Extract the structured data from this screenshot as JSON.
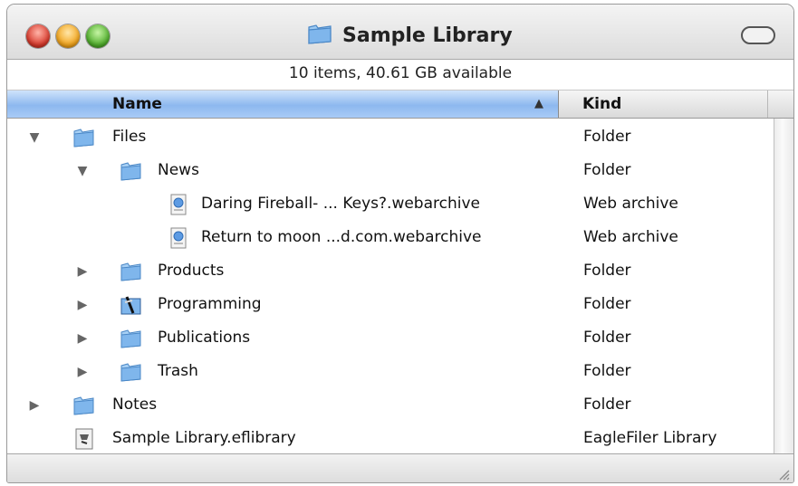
{
  "window": {
    "title": "Sample Library",
    "status": "10 items, 40.61 GB available"
  },
  "columns": {
    "name": "Name",
    "kind": "Kind"
  },
  "rows": [
    {
      "name": "Files",
      "kind": "Folder",
      "icon": "folder-icon",
      "expander": "expanded"
    },
    {
      "name": "News",
      "kind": "Folder",
      "icon": "folder-icon",
      "expander": "expanded"
    },
    {
      "name": "Daring Fireball- ... Keys?.webarchive",
      "kind": "Web archive",
      "icon": "webarchive-icon",
      "expander": "none"
    },
    {
      "name": "Return to moon ...d.com.webarchive",
      "kind": "Web archive",
      "icon": "webarchive-icon",
      "expander": "none"
    },
    {
      "name": "Products",
      "kind": "Folder",
      "icon": "folder-icon",
      "expander": "collapsed"
    },
    {
      "name": "Programming",
      "kind": "Folder",
      "icon": "programming-folder-icon",
      "expander": "collapsed"
    },
    {
      "name": "Publications",
      "kind": "Folder",
      "icon": "folder-icon",
      "expander": "collapsed"
    },
    {
      "name": "Trash",
      "kind": "Folder",
      "icon": "folder-icon",
      "expander": "collapsed"
    },
    {
      "name": "Notes",
      "kind": "Folder",
      "icon": "folder-icon",
      "expander": "collapsed"
    },
    {
      "name": "Sample Library.eflibrary",
      "kind": "EagleFiler Library",
      "icon": "library-file-icon",
      "expander": "none"
    }
  ],
  "colors": {
    "header_selected": "#8db8ef",
    "folder_blue": "#7fb6ec"
  }
}
